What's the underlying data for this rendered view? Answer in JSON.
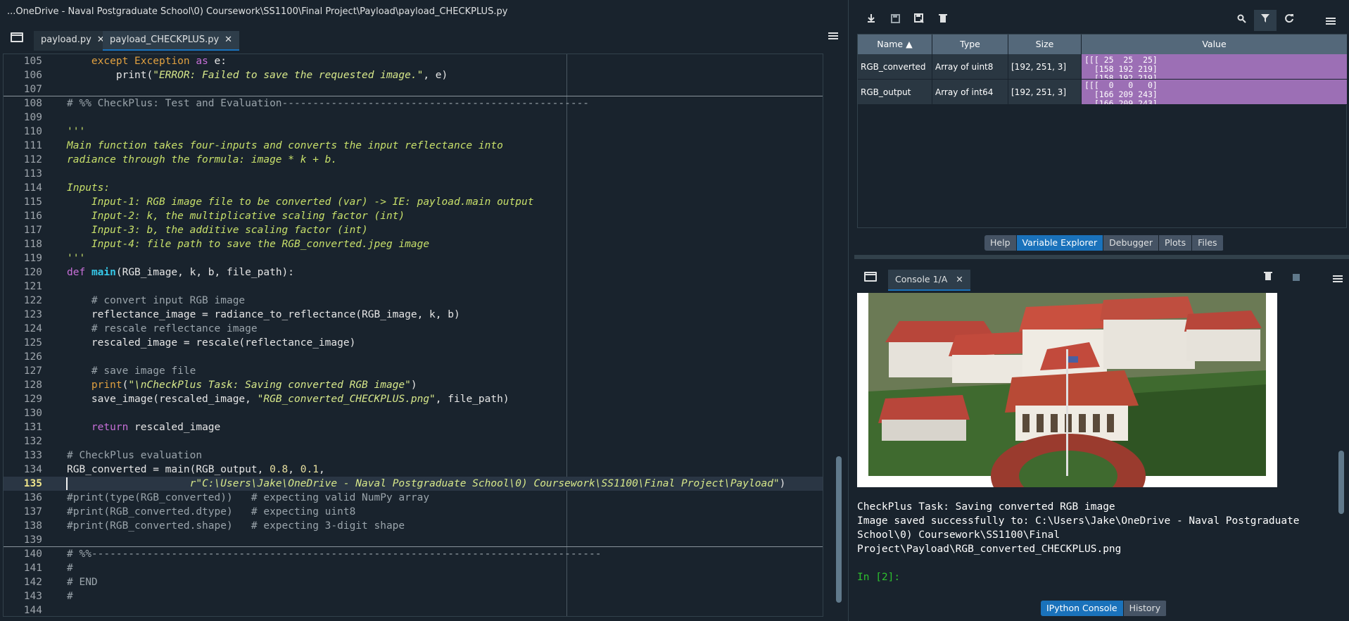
{
  "window_title": "...OneDrive - Naval Postgraduate School\\0) Coursework\\SS1100\\Final Project\\Payload\\payload_CHECKPLUS.py",
  "editor": {
    "tabs": [
      {
        "label": "payload.py",
        "close": "✕"
      },
      {
        "label": "payload_CHECKPLUS.py",
        "close": "✕"
      }
    ],
    "current_line": 135,
    "lines": [
      {
        "n": "105"
      },
      {
        "n": "106"
      },
      {
        "n": "107"
      },
      {
        "n": "108"
      },
      {
        "n": "109"
      },
      {
        "n": "110"
      },
      {
        "n": "111"
      },
      {
        "n": "112"
      },
      {
        "n": "113"
      },
      {
        "n": "114"
      },
      {
        "n": "115"
      },
      {
        "n": "116"
      },
      {
        "n": "117"
      },
      {
        "n": "118"
      },
      {
        "n": "119"
      },
      {
        "n": "120"
      },
      {
        "n": "121"
      },
      {
        "n": "122"
      },
      {
        "n": "123"
      },
      {
        "n": "124"
      },
      {
        "n": "125"
      },
      {
        "n": "126"
      },
      {
        "n": "127"
      },
      {
        "n": "128"
      },
      {
        "n": "129"
      },
      {
        "n": "130"
      },
      {
        "n": "131"
      },
      {
        "n": "132"
      },
      {
        "n": "133"
      },
      {
        "n": "134"
      },
      {
        "n": "135"
      },
      {
        "n": "136"
      },
      {
        "n": "137"
      },
      {
        "n": "138"
      },
      {
        "n": "139"
      },
      {
        "n": "140"
      },
      {
        "n": "141"
      },
      {
        "n": "142"
      },
      {
        "n": "143"
      },
      {
        "n": "144"
      }
    ],
    "code": {
      "l105": [
        "    ",
        "except",
        " ",
        "Exception",
        " ",
        "as",
        " e:"
      ],
      "l106": [
        "        print(",
        "\"ERROR: Failed to save the requested image.\"",
        ", e)"
      ],
      "l108": "# %% CheckPlus: Test and Evaluation--------------------------------------------------",
      "l110": "'''",
      "l111": "Main function takes four-inputs and converts the input reflectance into",
      "l112": "radiance through the formula: image * k + b.",
      "l114": "Inputs:",
      "l115": "    Input-1: RGB image file to be converted (var) -> IE: payload.main output",
      "l116": "    Input-2: k, the multiplicative scaling factor (int)",
      "l117": "    Input-3: b, the additive scaling factor (int)",
      "l118": "    Input-4: file path to save the RGB_converted.jpeg image",
      "l119": "'''",
      "l120": [
        "def",
        " ",
        "main",
        "(RGB_image, k, b, file_path):"
      ],
      "l122": "    # convert input RGB image",
      "l123": "    reflectance_image = radiance_to_reflectance(RGB_image, k, b)",
      "l124": "    # rescale reflectance image",
      "l125": "    rescaled_image = rescale(reflectance_image)",
      "l127": "    # save image file",
      "l128": [
        "    ",
        "print",
        "(",
        "\"\\nCheckPlus Task: Saving converted RGB image\"",
        ")"
      ],
      "l129": [
        "    save_image(rescaled_image, ",
        "\"RGB_converted_CHECKPLUS.png\"",
        ", file_path)"
      ],
      "l131": [
        "    ",
        "return",
        " rescaled_image"
      ],
      "l133": "# CheckPlus evaluation",
      "l134": [
        "RGB_converted = main(RGB_output, ",
        "0.8",
        ", ",
        "0.1",
        ","
      ],
      "l135": [
        "                    ",
        "r\"C:\\Users\\Jake\\OneDrive - Naval Postgraduate School\\0) Coursework\\SS1100\\Final Project\\Payload\"",
        ")"
      ],
      "l136": "#print(type(RGB_converted))   # expecting valid NumPy array",
      "l137": "#print(RGB_converted.dtype)   # expecting uint8",
      "l138": "#print(RGB_converted.shape)   # expecting 3-digit shape",
      "l140": "# %%-----------------------------------------------------------------------------------",
      "l141": "#",
      "l142": "# END",
      "l143": "#"
    }
  },
  "variable_explorer": {
    "columns": [
      "Name",
      "Type",
      "Size",
      "Value"
    ],
    "rows": [
      {
        "name": "RGB_converted",
        "type": "Array of uint8",
        "size": "[192, 251, 3]",
        "value": "[[[ 25  25  25]\n  [158 192 219]\n  [158 192 219]"
      },
      {
        "name": "RGB_output",
        "type": "Array of int64",
        "size": "[192, 251, 3]",
        "value": "[[[  0   0   0]\n  [166 209 243]\n  [166 209 243]"
      }
    ],
    "pane_tabs": [
      "Help",
      "Variable Explorer",
      "Debugger",
      "Plots",
      "Files"
    ],
    "active_pane_tab": "Variable Explorer"
  },
  "console": {
    "tab_label": "Console 1/A",
    "tab_close": "✕",
    "output": "CheckPlus Task: Saving converted RGB image\nImage saved successfully to: C:\\Users\\Jake\\OneDrive - Naval Postgraduate\nSchool\\0) Coursework\\SS1100\\Final\nProject\\Payload\\RGB_converted_CHECKPLUS.png",
    "prompt": "In [2]:",
    "pane_tabs": [
      "IPython Console",
      "History"
    ],
    "active_pane_tab": "IPython Console"
  },
  "icons": {
    "toolbar": [
      "import-data-icon",
      "save-data-icon",
      "save-data-as-icon",
      "remove-all-icon",
      "search-icon",
      "filter-icon",
      "refresh-icon",
      "options-menu-icon"
    ],
    "console_toolbar": [
      "clear-console-icon",
      "stop-icon",
      "options-menu-icon"
    ]
  },
  "colors": {
    "background": "#19232d",
    "accent": "#1a72bb",
    "value_highlight": "#9c6fb5",
    "prompt_green": "#2ec02e"
  }
}
